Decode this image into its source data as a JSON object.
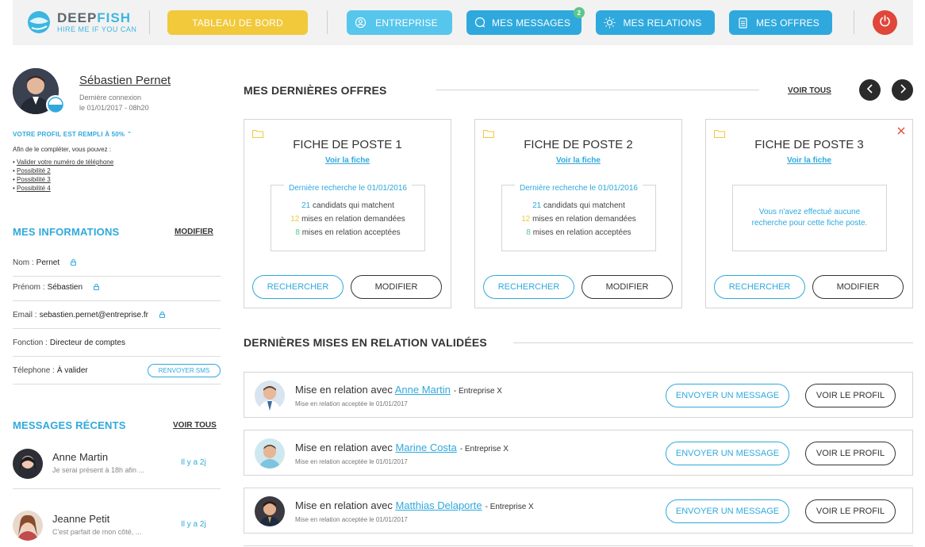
{
  "brand": {
    "name_a": "DEEP",
    "name_b": "FISH",
    "tagline": "HIRE ME IF YOU CAN"
  },
  "nav": {
    "dashboard": "TABLEAU DE BORD",
    "company": "ENTREPRISE",
    "messages": "MES MESSAGES",
    "messages_badge": "2",
    "relations": "MES RELATIONS",
    "offers": "MES OFFRES"
  },
  "user": {
    "name": "Sébastien Pernet",
    "last_login_label": "Dernière connexion",
    "last_login_value": "le 01/01/2017 - 08h20"
  },
  "profile": {
    "fill_status": "VOTRE PROFIL EST REMPLI À 50%",
    "help": "Afin de le compléter, vous pouvez :",
    "possibilities": [
      "Valider votre numéro de téléphone",
      "Possibilité 2",
      "Possibilité 3",
      "Possibilité 4"
    ]
  },
  "info": {
    "title": "MES INFORMATIONS",
    "edit": "MODIFIER",
    "rows": [
      {
        "label": "Nom :",
        "value": "Pernet"
      },
      {
        "label": "Prénom :",
        "value": "Sébastien"
      },
      {
        "label": "Email :",
        "value": "sebastien.pernet@entreprise.fr"
      },
      {
        "label": "Fonction :",
        "value": "Directeur de comptes"
      },
      {
        "label": "Télephone :",
        "value": "À valider"
      }
    ],
    "sms_button": "RENVOYER SMS"
  },
  "messages": {
    "title": "MESSAGES RÉCENTS",
    "see_all": "VOIR TOUS",
    "items": [
      {
        "name": "Anne Martin",
        "snippet": "Je serai présent à 18h afin ...",
        "time": "Il y a 2j"
      },
      {
        "name": "Jeanne Petit",
        "snippet": "C'est parfait de mon côté, ...",
        "time": "Il y a 2j"
      }
    ]
  },
  "offers": {
    "title": "MES DERNIÈRES OFFRES",
    "see_all": "VOIR TOUS",
    "cards": [
      {
        "title": "FICHE DE POSTE 1",
        "link": "Voir la fiche",
        "legend": "Dernière recherche le 01/01/2016",
        "stats": [
          {
            "n": "21",
            "text": "candidats qui matchent"
          },
          {
            "n": "12",
            "text": "mises en relation demandées"
          },
          {
            "n": "8",
            "text": "mises en relation acceptées"
          }
        ],
        "search": "RECHERCHER",
        "edit": "MODIFIER"
      },
      {
        "title": "FICHE DE POSTE 2",
        "link": "Voir la fiche",
        "legend": "Dernière recherche le 01/01/2016",
        "stats": [
          {
            "n": "21",
            "text": "candidats qui matchent"
          },
          {
            "n": "12",
            "text": "mises en relation demandées"
          },
          {
            "n": "8",
            "text": "mises en relation acceptées"
          }
        ],
        "search": "RECHERCHER",
        "edit": "MODIFIER"
      },
      {
        "title": "FICHE DE POSTE 3",
        "link": "Voir la fiche",
        "empty": "Vous n'avez effectué aucune recherche pour cette fiche poste.",
        "search": "RECHERCHER",
        "edit": "MODIFIER"
      }
    ]
  },
  "relations": {
    "title": "DERNIÈRES MISES EN RELATION VALIDÉES",
    "prefix": "Mise en relation avec",
    "items": [
      {
        "person": "Anne Martin",
        "company": "- Entreprise X",
        "sub": "Mise en relation acceptée le 01/01/2017"
      },
      {
        "person": "Marine Costa",
        "company": "- Entreprise X",
        "sub": "Mise en relation acceptée le 01/01/2017"
      },
      {
        "person": "Matthias Delaporte",
        "company": "- Entreprise X",
        "sub": "Mise en relation acceptée le 01/01/2017"
      }
    ],
    "message_button": "ENVOYER UN MESSAGE",
    "profile_button": "VOIR LE PROFIL"
  },
  "colors": {
    "accent": "#2fa9dd",
    "accent_light": "#57c6ec",
    "yellow": "#f1c93a",
    "green": "#5dc68a",
    "danger": "#e0463a"
  }
}
